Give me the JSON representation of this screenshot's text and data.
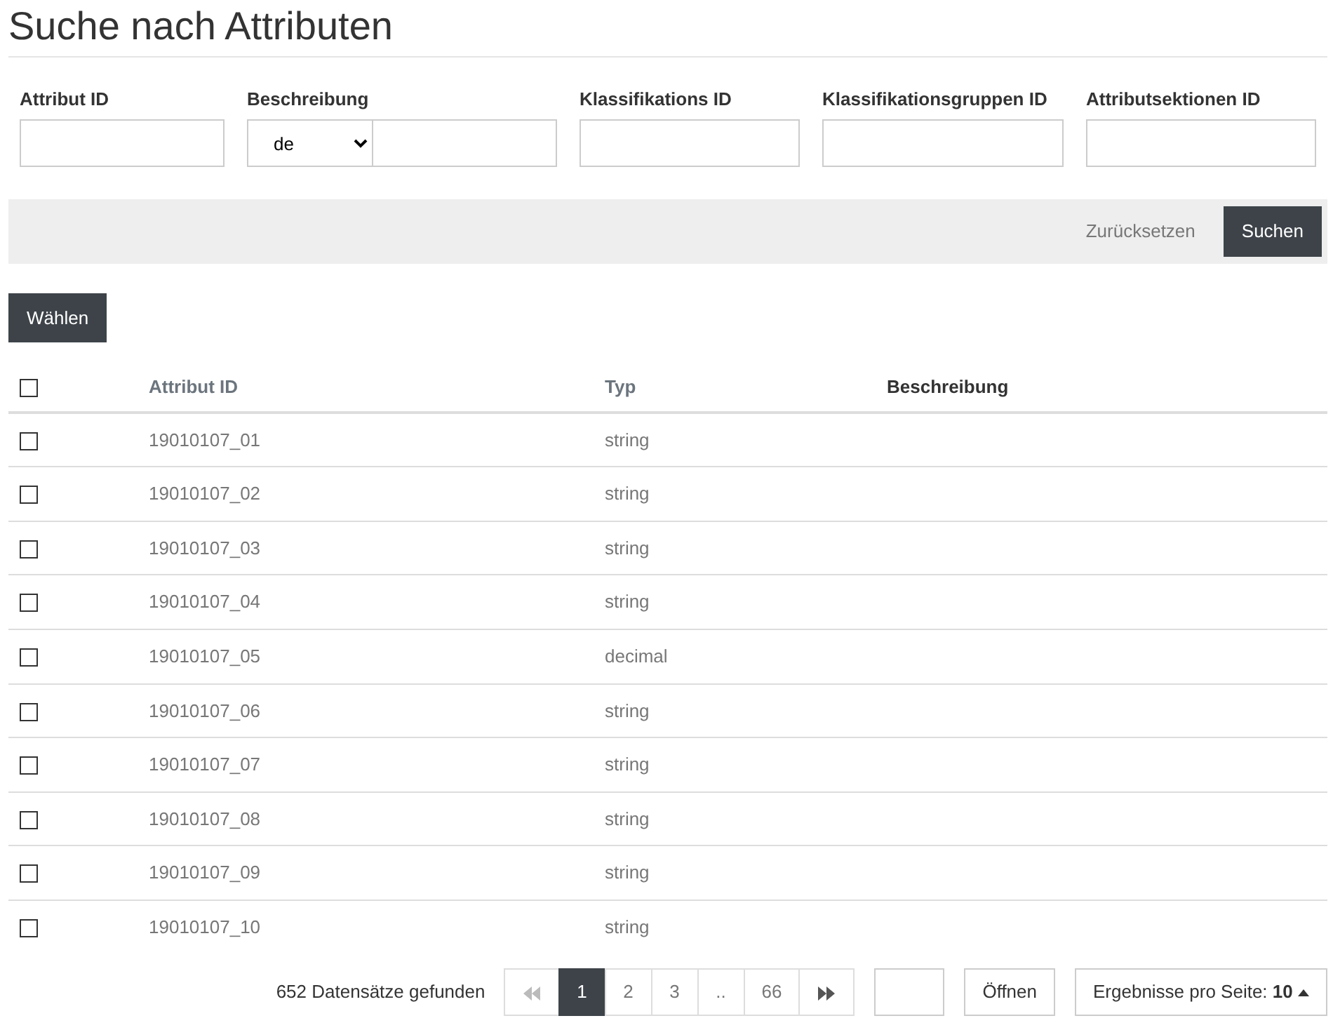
{
  "title": "Suche nach Attributen",
  "filters": [
    {
      "kind": "text",
      "label": "Attribut ID"
    },
    {
      "kind": "lang",
      "label": "Beschreibung",
      "select_value": "de"
    },
    {
      "kind": "text",
      "label": "Klassifikations ID"
    },
    {
      "kind": "text",
      "label": "Klassifikationsgruppen ID"
    },
    {
      "kind": "text",
      "label": "Attributsektionen ID"
    }
  ],
  "actions": {
    "reset": "Zurücksetzen",
    "search": "Suchen"
  },
  "select_button": "Wählen",
  "table": {
    "header_checked": false,
    "columns": [
      {
        "label": "Attribut ID",
        "kind": "link"
      },
      {
        "label": "Typ",
        "kind": "link"
      },
      {
        "label": "Beschreibung",
        "kind": "plain"
      }
    ],
    "rows": [
      {
        "checked": false,
        "cells": [
          "19010107_01",
          "string",
          ""
        ]
      },
      {
        "checked": false,
        "cells": [
          "19010107_02",
          "string",
          ""
        ]
      },
      {
        "checked": false,
        "cells": [
          "19010107_03",
          "string",
          ""
        ]
      },
      {
        "checked": false,
        "cells": [
          "19010107_04",
          "string",
          ""
        ]
      },
      {
        "checked": false,
        "cells": [
          "19010107_05",
          "decimal",
          ""
        ]
      },
      {
        "checked": false,
        "cells": [
          "19010107_06",
          "string",
          ""
        ]
      },
      {
        "checked": false,
        "cells": [
          "19010107_07",
          "string",
          ""
        ]
      },
      {
        "checked": false,
        "cells": [
          "19010107_08",
          "string",
          ""
        ]
      },
      {
        "checked": false,
        "cells": [
          "19010107_09",
          "string",
          ""
        ]
      },
      {
        "checked": false,
        "cells": [
          "19010107_10",
          "string",
          ""
        ]
      }
    ]
  },
  "footer": {
    "count": "652 Datensätze gefunden",
    "pages": [
      {
        "kind": "first",
        "disabled": true
      },
      {
        "kind": "page",
        "label": "1",
        "selected": true
      },
      {
        "kind": "page",
        "label": "2",
        "selected": false
      },
      {
        "kind": "page",
        "label": "3",
        "selected": false
      },
      {
        "kind": "page",
        "label": "..",
        "selected": false
      },
      {
        "kind": "page",
        "label": "66",
        "selected": false
      },
      {
        "kind": "last",
        "disabled": false
      }
    ],
    "open": "Öffnen",
    "per_page": "Ergebnisse pro Seite: **10**"
  }
}
